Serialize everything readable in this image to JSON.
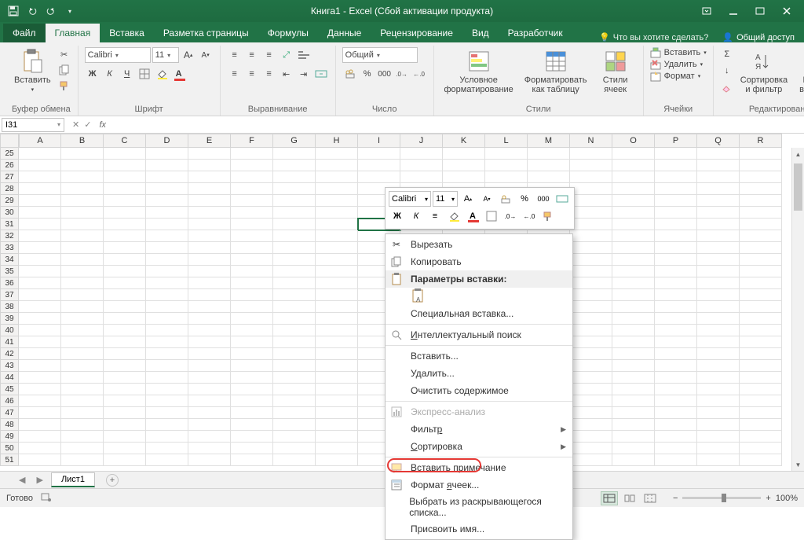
{
  "title": "Книга1 - Excel (Сбой активации продукта)",
  "tabs": {
    "file": "Файл",
    "home": "Главная",
    "insert": "Вставка",
    "pagelayout": "Разметка страницы",
    "formulas": "Формулы",
    "data": "Данные",
    "review": "Рецензирование",
    "view": "Вид",
    "developer": "Разработчик",
    "tellme": "Что вы хотите сделать?",
    "share": "Общий доступ"
  },
  "ribbon": {
    "clipboard": {
      "label": "Буфер обмена",
      "paste": "Вставить"
    },
    "font": {
      "label": "Шрифт",
      "name": "Calibri",
      "size": "11"
    },
    "alignment": {
      "label": "Выравнивание"
    },
    "number": {
      "label": "Число",
      "format": "Общий"
    },
    "styles": {
      "label": "Стили",
      "cond": "Условное форматирование",
      "table": "Форматировать как таблицу",
      "cell": "Стили ячеек"
    },
    "cells": {
      "label": "Ячейки",
      "insert": "Вставить",
      "delete": "Удалить",
      "format": "Формат"
    },
    "editing": {
      "label": "Редактирование",
      "sort": "Сортировка и фильтр",
      "find": "Найти и выделить"
    }
  },
  "namebox": "I31",
  "columns": [
    "A",
    "B",
    "C",
    "D",
    "E",
    "F",
    "G",
    "H",
    "I",
    "J",
    "K",
    "L",
    "M",
    "N",
    "O",
    "P",
    "Q",
    "R"
  ],
  "rowStart": 25,
  "rowCount": 27,
  "selectedCell": {
    "col": "I",
    "row": 31
  },
  "miniToolbar": {
    "font": "Calibri",
    "size": "11"
  },
  "contextMenu": {
    "cut": "Вырезать",
    "copy": "Копировать",
    "pasteHeader": "Параметры вставки:",
    "pasteSpecial": "Специальная вставка...",
    "smartLookup": "Интеллектуальный поиск",
    "insert": "Вставить...",
    "delete": "Удалить...",
    "clear": "Очистить содержимое",
    "quickAnalysis": "Экспресс-анализ",
    "filter": "Фильтр",
    "sort": "Сортировка",
    "insertComment": "Вставить примечание",
    "formatCells": "Формат ячеек...",
    "pickList": "Выбрать из раскрывающегося списка...",
    "defineName": "Присвоить имя..."
  },
  "sheet": {
    "name": "Лист1"
  },
  "status": {
    "ready": "Готово",
    "zoom": "100%"
  }
}
